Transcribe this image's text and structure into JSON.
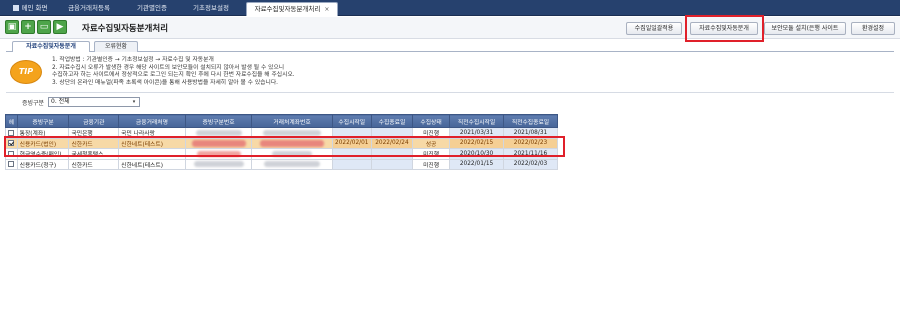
{
  "tabs": {
    "home": "메인 화면",
    "t1": "금융거래처등록",
    "t2": "기관별인증",
    "t3": "기초정보설정",
    "active": "자료수집및자동분개처리",
    "close": "×"
  },
  "toolbar": {
    "icons": [
      "save-icon",
      "add-icon",
      "window-icon",
      "play-icon"
    ],
    "icon_glyphs": [
      "▣",
      "+",
      "▭",
      "▶"
    ],
    "title": "자료수집및자동분개처리",
    "buttons": [
      "수집일일괄적용",
      "자료수집및자동분개",
      "보안모듈 설치(은행 사이트",
      "환경설정"
    ]
  },
  "subtabs": [
    "자료수집및자동분개",
    "오류현황"
  ],
  "tip": {
    "badge": "TIP",
    "lines": [
      "1. 작업방법 : 기관별인증 → 기초정보설정 → 자료수집 및 자동분개",
      "2. 자료수집시 오류가 발생한 경우 해당 사이트의 보안모듈이 설치되지 않아서 발생 될 수 있으니",
      "   수집하고자 하는 사이트에서 정상적으로 로그인 되는지 확인 후에 다시 한번 자료수집을 해 주십시오.",
      "3. 상단의 온라인 매뉴얼(파족 초록색 아이콘)을 통해 사용방법을 자세히 알아 볼 수 있습니다."
    ]
  },
  "filter": {
    "label": "증빙구분",
    "value": "0. 전체",
    "arrow": "▾"
  },
  "grid": {
    "columns": [
      "헤",
      "증빙구분",
      "금융기관",
      "금융거래처명",
      "증빙구분번호",
      "거래처계좌번호",
      "수집시작일",
      "수집종료일",
      "수집상태",
      "직전수집시작일",
      "직전수집종료일"
    ],
    "rows": [
      {
        "checked": false,
        "type": "통장(계좌)",
        "bank": "국민은행",
        "name": "국민 나라사랑",
        "start": "",
        "end": "",
        "status": "미진행",
        "prev_start": "2021/03/31",
        "prev_end": "2021/08/31",
        "selected": false
      },
      {
        "checked": true,
        "type": "신용카드(법인)",
        "bank": "신한카드",
        "name": "신한네트(테스트)",
        "start": "2022/02/01",
        "end": "2022/02/24",
        "status": "성공",
        "prev_start": "2022/02/15",
        "prev_end": "2022/02/23",
        "selected": true
      },
      {
        "checked": false,
        "type": "현금영수증(매입)",
        "bank": "국세청홈택스",
        "name": "",
        "start": "",
        "end": "",
        "status": "미진행",
        "prev_start": "2020/10/30",
        "prev_end": "2021/11/16",
        "selected": false
      },
      {
        "checked": false,
        "type": "신용카드(청구)",
        "bank": "신한카드",
        "name": "신한네트(테스트)",
        "start": "",
        "end": "",
        "status": "미진행",
        "prev_start": "2022/01/15",
        "prev_end": "2022/02/03",
        "selected": false
      }
    ]
  },
  "colors": {
    "tabbar": "#26416e",
    "header": "#476598",
    "selected_row": "#f7d9a6",
    "highlight": "#e0202a",
    "tip": "#f4a31c"
  }
}
